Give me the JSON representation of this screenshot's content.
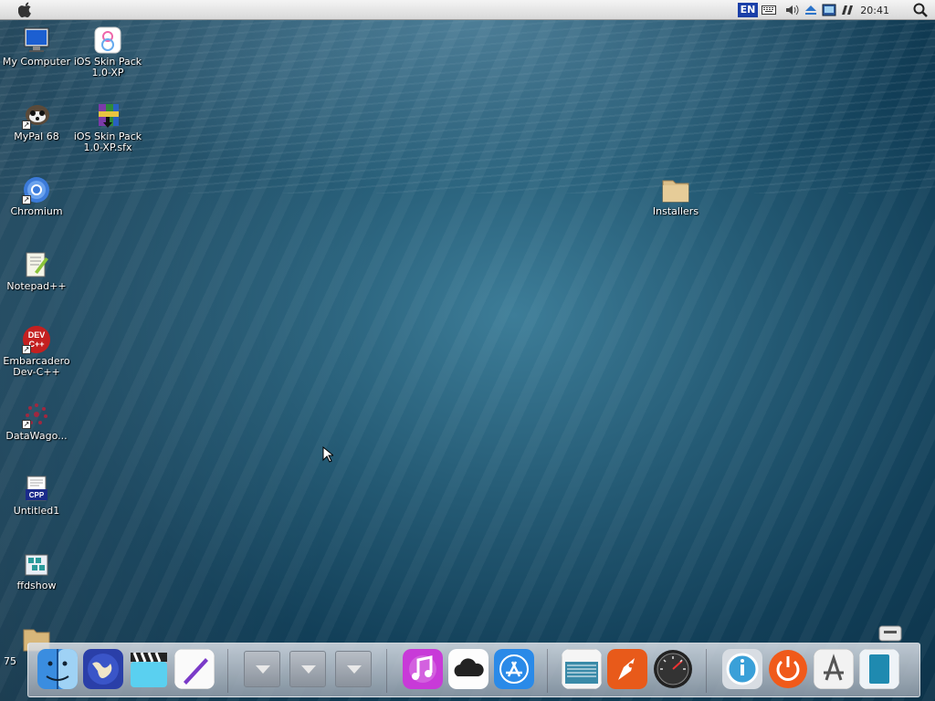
{
  "menubar": {
    "language": "EN",
    "clock": "20:41"
  },
  "desktop_icons": [
    {
      "label": "My Computer"
    },
    {
      "label": "iOS Skin Pack 1.0-XP"
    },
    {
      "label": "MyPal 68"
    },
    {
      "label": "iOS Skin Pack 1.0-XP.sfx"
    },
    {
      "label": "Chromium"
    },
    {
      "label": "Notepad++"
    },
    {
      "label": "Embarcadero Dev-C++"
    },
    {
      "label": "DataWago..."
    },
    {
      "label": "Untitled1"
    },
    {
      "label": "ffdshow"
    },
    {
      "label": "Installers"
    }
  ],
  "partial_text": "75",
  "dock": {
    "items": [
      {
        "name": "finder"
      },
      {
        "name": "globe"
      },
      {
        "name": "video"
      },
      {
        "name": "pen"
      },
      {
        "name": "stack-1"
      },
      {
        "name": "stack-2"
      },
      {
        "name": "stack-3"
      },
      {
        "name": "music"
      },
      {
        "name": "cloud"
      },
      {
        "name": "app-store"
      },
      {
        "name": "news"
      },
      {
        "name": "rocket"
      },
      {
        "name": "speedometer"
      },
      {
        "name": "info"
      },
      {
        "name": "power"
      },
      {
        "name": "app-maker"
      },
      {
        "name": "trash"
      }
    ]
  },
  "colors": {
    "menubar": "#e6e6e6",
    "lang_badge": "#1a3fa8",
    "desktop": "#1f516a"
  }
}
